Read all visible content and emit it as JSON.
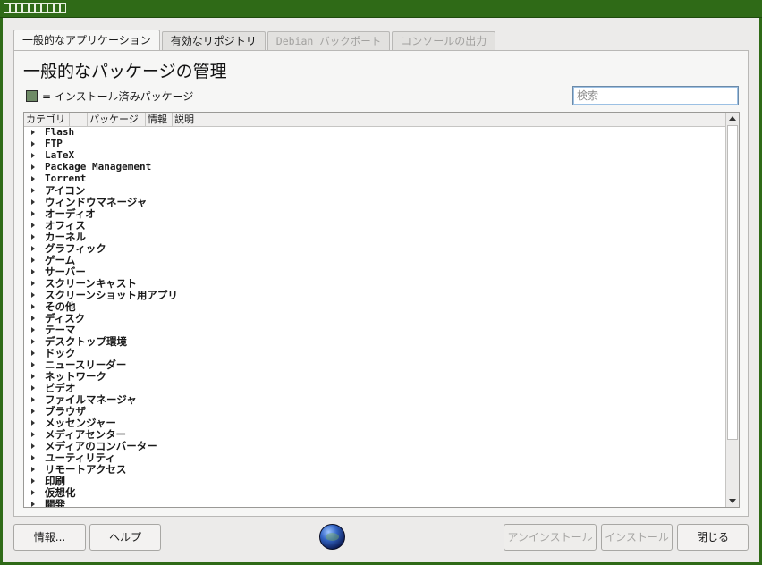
{
  "window": {
    "title_glyph_count": 10
  },
  "tabs": [
    {
      "label": "一般的なアプリケーション",
      "state": "active"
    },
    {
      "label": "有効なリポジトリ",
      "state": "normal"
    },
    {
      "label": "Debian バックポート",
      "state": "disabled"
    },
    {
      "label": "コンソールの出力",
      "state": "disabled"
    }
  ],
  "main": {
    "heading": "一般的なパッケージの管理",
    "legend_text": "= インストール済みパッケージ",
    "legend_color": "#6e8a66",
    "search": {
      "placeholder": "検索",
      "value": ""
    }
  },
  "table": {
    "columns": [
      "カテゴリ",
      "",
      "パッケージ",
      "情報",
      "説明"
    ],
    "rows": [
      "Flash",
      "FTP",
      "LaTeX",
      "Package Management",
      "Torrent",
      "アイコン",
      "ウィンドウマネージャ",
      "オーディオ",
      "オフィス",
      "カーネル",
      "グラフィック",
      "ゲーム",
      "サーバー",
      "スクリーンキャスト",
      "スクリーンショット用アプリ",
      "その他",
      "ディスク",
      "テーマ",
      "デスクトップ環境",
      "ドック",
      "ニュースリーダー",
      "ネットワーク",
      "ビデオ",
      "ファイルマネージャ",
      "ブラウザ",
      "メッセンジャー",
      "メディアセンター",
      "メディアのコンバーター",
      "ユーティリティ",
      "リモートアクセス",
      "印刷",
      "仮想化",
      "開発"
    ]
  },
  "buttons": {
    "info": "情報...",
    "help": "ヘルプ",
    "uninstall": "アンインストール",
    "install": "インストール",
    "close": "閉じる"
  },
  "colors": {
    "titlebar": "#2f6a17",
    "window_bg": "#ecebea"
  }
}
